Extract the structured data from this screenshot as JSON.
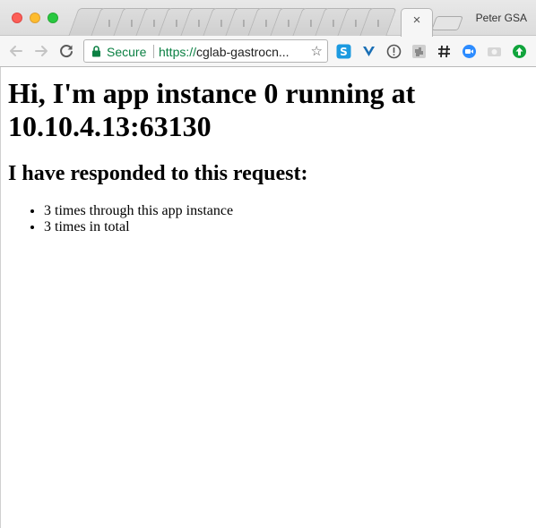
{
  "window": {
    "profile_name": "Peter GSA",
    "active_tab_close": "×"
  },
  "toolbar": {
    "secure_label": "Secure",
    "url_scheme": "https://",
    "url_host": "cglab-gastrocn...",
    "bookmark_icon": "☆"
  },
  "extensions": [
    "skype-icon",
    "v-icon",
    "info-icon",
    "puzzle-icon",
    "hashtag-icon",
    "zoom-icon",
    "camera-icon",
    "update-arrow-icon"
  ],
  "colors": {
    "secure_green": "#0b8043",
    "close_red": "#fc5f57",
    "minimize_yellow": "#fdbc2e",
    "maximize_green": "#28c840"
  },
  "page": {
    "heading": "Hi, I'm app instance 0 running at 10.10.4.13:63130",
    "subheading": "I have responded to this request:",
    "items": [
      "3 times through this app instance",
      "3 times in total"
    ]
  }
}
